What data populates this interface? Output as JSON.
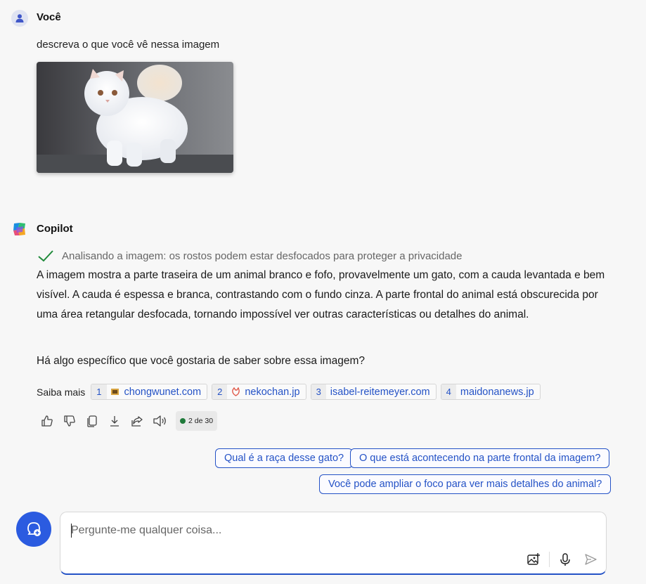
{
  "user": {
    "name": "Você",
    "message": "descreva o que você vê nessa imagem"
  },
  "copilot": {
    "name": "Copilot",
    "status": "Analisando a imagem: os rostos podem estar desfocados para proteger a privacidade",
    "answer": "A imagem mostra a parte traseira de um animal branco e fofo, provavelmente um gato, com a cauda levantada e bem visível. A cauda é espessa e branca, contrastando com o fundo cinza. A parte frontal do animal está obscurecida por uma área retangular desfocada, tornando impossível ver outras características ou detalhes do animal.",
    "question": "Há algo específico que você gostaria de saber sobre essa imagem?",
    "learn_more_label": "Saiba mais",
    "sources": [
      {
        "num": "1",
        "domain": "chongwunet.com",
        "icon": "site-favicon"
      },
      {
        "num": "2",
        "domain": "nekochan.jp",
        "icon": "cat-favicon"
      },
      {
        "num": "3",
        "domain": "isabel-reitemeyer.com",
        "icon": ""
      },
      {
        "num": "4",
        "domain": "maidonanews.jp",
        "icon": ""
      }
    ],
    "counter": "2 de 30",
    "actions": [
      "thumbs-up-icon",
      "thumbs-down-icon",
      "copy-icon",
      "download-icon",
      "share-icon",
      "speaker-icon"
    ]
  },
  "suggestions": [
    "Qual é a raça desse gato?",
    "O que está acontecendo na parte frontal da imagem?",
    "Você pode ampliar o foco para ver mais detalhes do animal?"
  ],
  "input": {
    "placeholder": "Pergunte-me qualquer coisa..."
  },
  "colors": {
    "accent": "#2452c6",
    "button": "#2b5be0",
    "status_check": "#1f8a3a"
  }
}
